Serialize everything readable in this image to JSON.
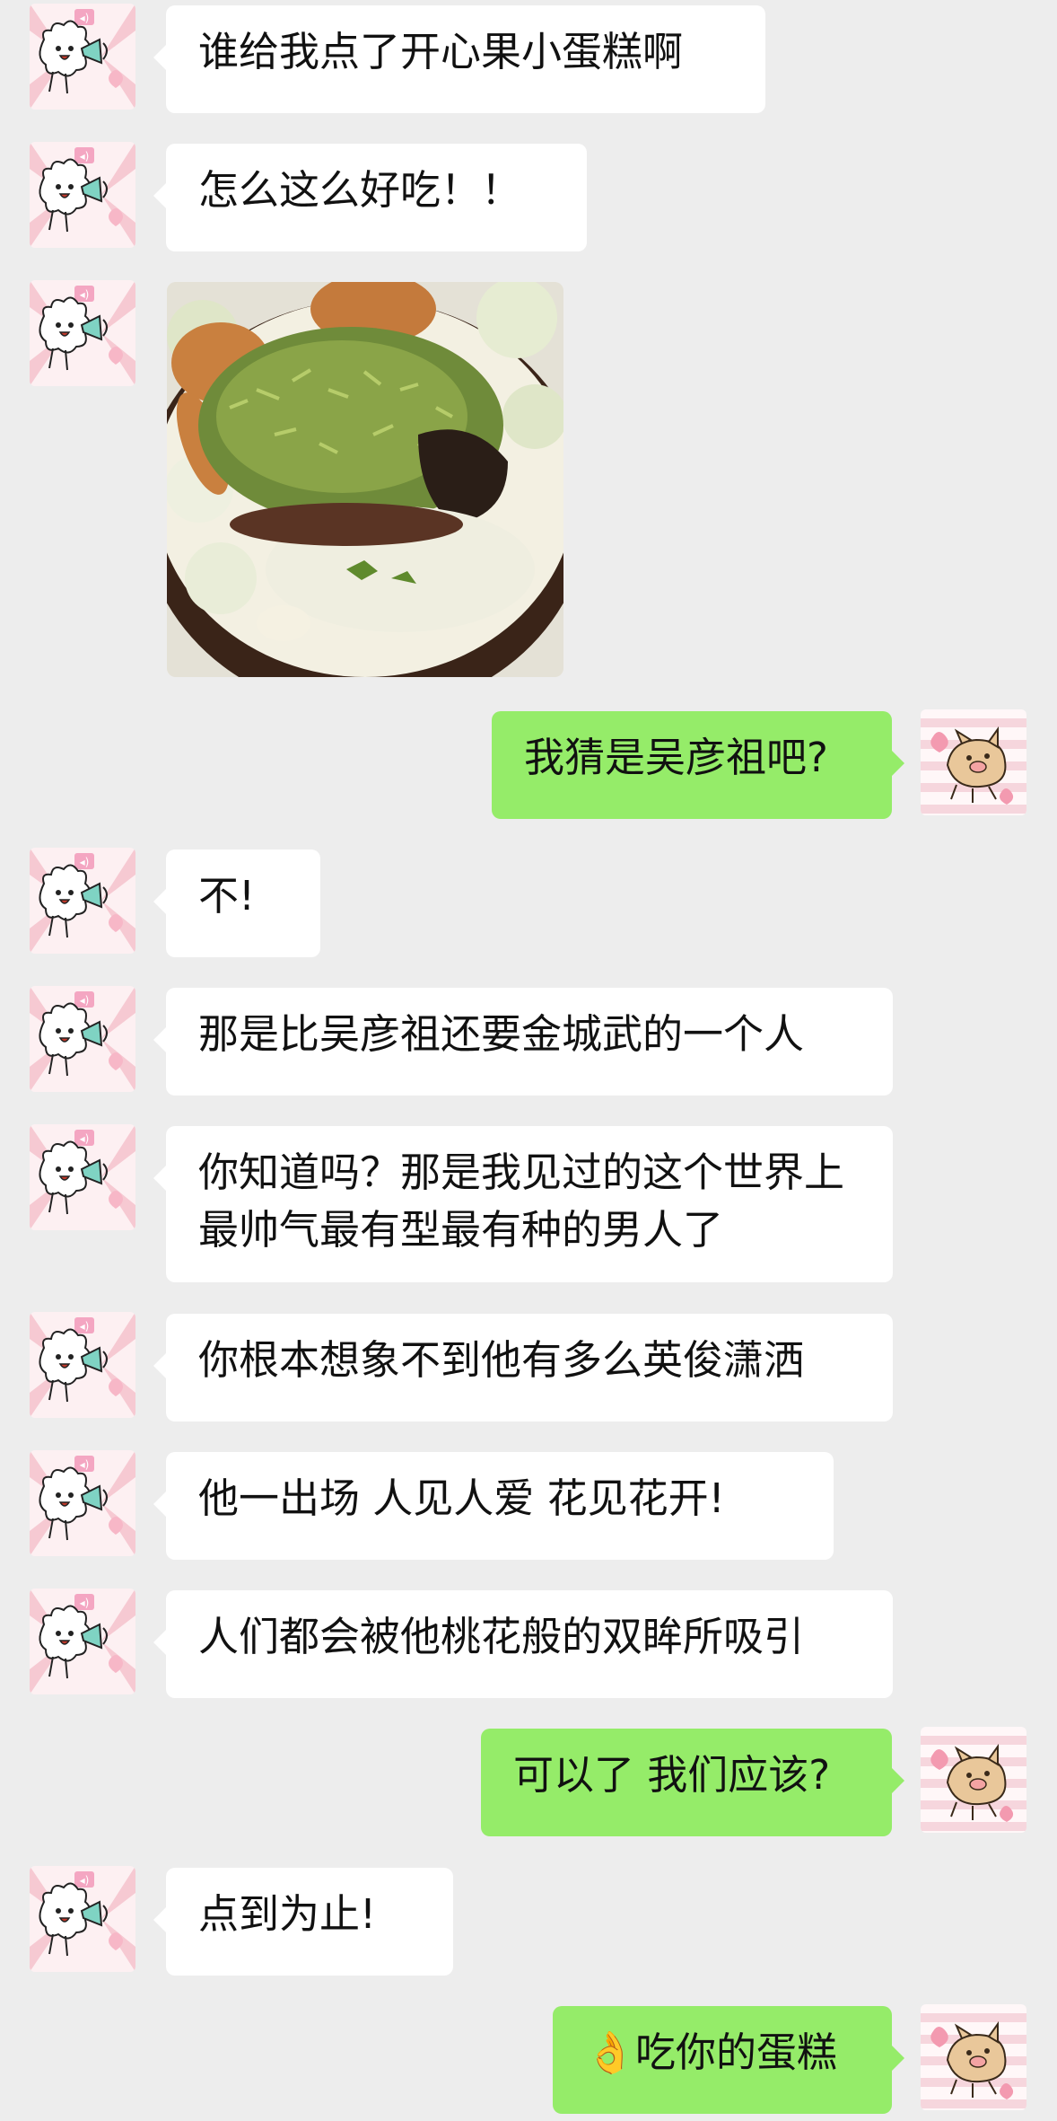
{
  "conversation": {
    "messages": [
      {
        "side": "in",
        "text": "谁给我点了开心果小蛋糕啊"
      },
      {
        "side": "in",
        "text": "怎么这么好吃！！"
      },
      {
        "side": "in",
        "type": "image",
        "alt": ""
      },
      {
        "side": "out",
        "text": "我猜是吴彦祖吧?"
      },
      {
        "side": "in",
        "text": "不!"
      },
      {
        "side": "in",
        "text": "那是比吴彦祖还要金城武的一个人"
      },
      {
        "side": "in",
        "text": "你知道吗？那是我见过的这个世界上最帅气最有型最有种的男人了"
      },
      {
        "side": "in",
        "text": "你根本想象不到他有多么英俊潇洒"
      },
      {
        "side": "in",
        "text": "他一出场 人见人爱 花见花开!"
      },
      {
        "side": "in",
        "text": "人们都会被他桃花般的双眸所吸引"
      },
      {
        "side": "out",
        "text": "可以了 我们应该?"
      },
      {
        "side": "in",
        "text": "点到为止!"
      },
      {
        "side": "out",
        "text": "👌吃你的蛋糕"
      }
    ]
  },
  "avatars": {
    "incoming_icon": "white-lamb-with-megaphone-sticker",
    "outgoing_icon": "flying-pig-with-hearts-sticker"
  },
  "colors": {
    "background": "#ededed",
    "incoming_bubble": "#ffffff",
    "outgoing_bubble": "#95ec69"
  }
}
